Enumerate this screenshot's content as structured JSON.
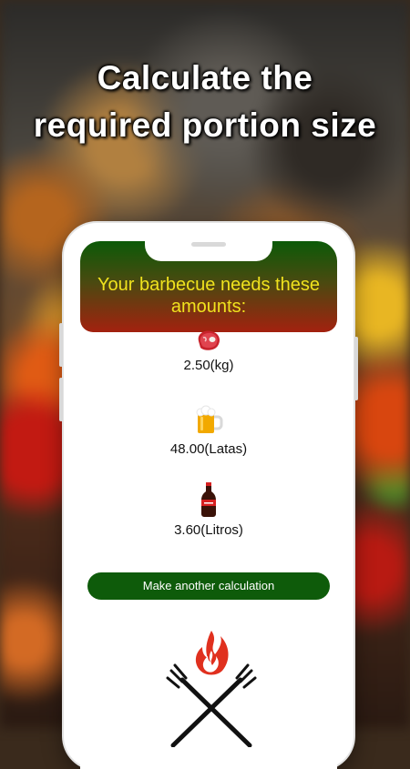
{
  "headline": "Calculate the required portion size",
  "app": {
    "header_title": "Your barbecue needs these amounts:",
    "items": [
      {
        "icon": "steak-icon",
        "value": "2.50(kg)"
      },
      {
        "icon": "beer-mug-icon",
        "value": "48.00(Latas)"
      },
      {
        "icon": "soda-bottle-icon",
        "value": "3.60(Litros)"
      }
    ],
    "action_button": "Make another calculation",
    "logo_icon": "grill-fork-flame-icon"
  },
  "colors": {
    "header_top": "#0b5a08",
    "header_bottom": "#a3210f",
    "header_text": "#f0e21e",
    "button_bg": "#0e5b0a"
  }
}
